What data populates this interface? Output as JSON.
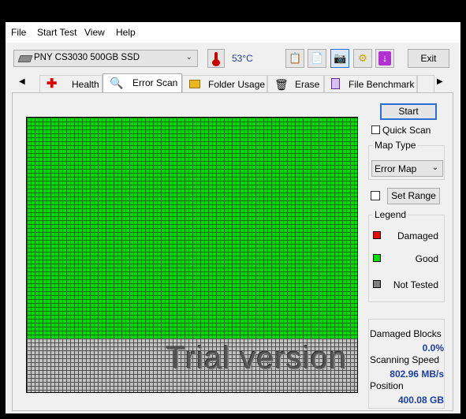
{
  "menu": [
    "File",
    "Start Test",
    "View",
    "Help"
  ],
  "toolbar": {
    "drive": "PNY CS3030 500GB SSD",
    "temperature": "53°C",
    "exit_label": "Exit"
  },
  "tabs": [
    "Health",
    "Error Scan",
    "Folder Usage",
    "Erase",
    "File Benchmark"
  ],
  "selected_tab": "Error Scan",
  "scan": {
    "start_label": "Start",
    "quick_scan_label": "Quick Scan",
    "map_type_caption": "Map Type",
    "map_type_value": "Error Map",
    "set_range_label": "Set Range",
    "legend_caption": "Legend",
    "legend": [
      {
        "label": "Damaged",
        "color": "#ff0000"
      },
      {
        "label": "Good",
        "color": "#00dd00"
      },
      {
        "label": "Not Tested",
        "color": "#808080"
      }
    ],
    "watermark": "Trial version",
    "scanned_fraction": 0.8
  },
  "stats": {
    "damaged_blocks_label": "Damaged Blocks",
    "damaged_blocks_value": "0.0%",
    "scanning_speed_label": "Scanning Speed",
    "scanning_speed_value": "802.96 MB/s",
    "position_label": "Position",
    "position_value": "400.08 GB"
  }
}
